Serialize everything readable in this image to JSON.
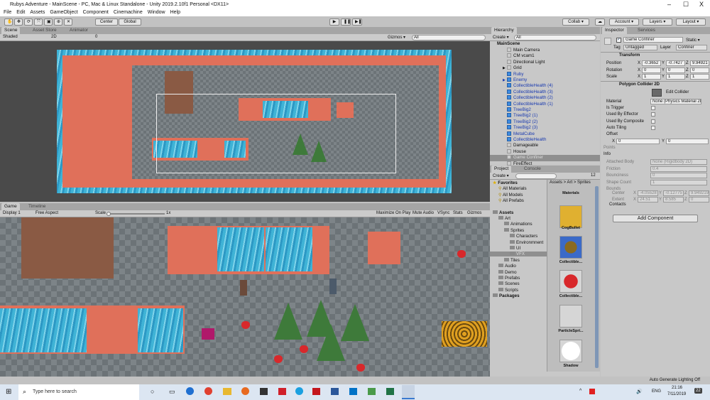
{
  "window": {
    "title": "Rubys Adventure - MainScene - PC, Mac & Linux Standalone - Unity 2019.2.10f1 Personal <DX11>",
    "minimize": "–",
    "maximize": "☐",
    "close": "X"
  },
  "menu": [
    "File",
    "Edit",
    "Assets",
    "GameObject",
    "Component",
    "Cinemachine",
    "Window",
    "Help"
  ],
  "toolbar": {
    "tools": [
      "✋",
      "✥",
      "⟳",
      "⤧",
      "▣",
      "⊕",
      "✕"
    ],
    "pivot": "Center",
    "space": "Global",
    "play": "▶",
    "pause": "❚❚",
    "step": "▶❚",
    "collab": "Collab ▾",
    "cloud": "☁",
    "account": "Account ▾",
    "layers": "Layers ▾",
    "layout": "Layout ▾"
  },
  "scene": {
    "tabs": [
      "Scene",
      "Asset Store",
      "Animator"
    ],
    "shading": "Shaded",
    "mode2d": "2D",
    "gizmos": "Gizmos ▾",
    "search_placeholder": "All",
    "fx_count": "0"
  },
  "game": {
    "tabs": [
      "Game",
      "Timeline"
    ],
    "display": "Display 1",
    "aspect": "Free Aspect",
    "scale_label": "Scale",
    "scale_value": "1x",
    "scale_fraction": 0.0,
    "buttons": [
      "Maximize On Play",
      "Mute Audio",
      "VSync",
      "Stats",
      "Gizmos"
    ]
  },
  "hierarchy": {
    "tab": "Hierarchy",
    "create": "Create ▾",
    "search_placeholder": "All",
    "scene": "MainScene",
    "items": [
      {
        "label": "Main Camera",
        "prefab": false
      },
      {
        "label": "CM vcam1",
        "prefab": false
      },
      {
        "label": "Directional Light",
        "prefab": false
      },
      {
        "label": "Grid",
        "prefab": false,
        "expand": true
      },
      {
        "label": "Ruby",
        "prefab": true
      },
      {
        "label": "Enemy",
        "prefab": true,
        "expand": true
      },
      {
        "label": "CollectibleHealth (4)",
        "prefab": true
      },
      {
        "label": "CollectibleHealth (3)",
        "prefab": true
      },
      {
        "label": "CollectibleHealth (2)",
        "prefab": true
      },
      {
        "label": "CollectibleHealth (1)",
        "prefab": true
      },
      {
        "label": "TreeBig2",
        "prefab": true
      },
      {
        "label": "TreeBig2 (1)",
        "prefab": true
      },
      {
        "label": "TreeBig2 (2)",
        "prefab": true
      },
      {
        "label": "TreeBig2 (3)",
        "prefab": true
      },
      {
        "label": "MetalCube",
        "prefab": true
      },
      {
        "label": "CollectibleHealth",
        "prefab": true
      },
      {
        "label": "Damageable",
        "prefab": false
      },
      {
        "label": "House",
        "prefab": false
      },
      {
        "label": "Game Confiner",
        "prefab": false,
        "selected": true
      },
      {
        "label": "FireEffect",
        "prefab": false
      }
    ]
  },
  "project": {
    "tabs": [
      "Project",
      "Console"
    ],
    "create": "Create ▾",
    "count": "12",
    "breadcrumb": [
      "Assets",
      "Art",
      "Sprites"
    ],
    "tree": [
      {
        "label": "Favorites",
        "level": 0,
        "bold": true,
        "icon": "star"
      },
      {
        "label": "All Materials",
        "level": 1,
        "icon": "search"
      },
      {
        "label": "All Models",
        "level": 1,
        "icon": "search"
      },
      {
        "label": "All Prefabs",
        "level": 1,
        "icon": "search"
      },
      {
        "label": "Assets",
        "level": 0,
        "bold": true,
        "gap": true
      },
      {
        "label": "Art",
        "level": 1
      },
      {
        "label": "Animations",
        "level": 2
      },
      {
        "label": "Sprites",
        "level": 2
      },
      {
        "label": "Characters",
        "level": 3
      },
      {
        "label": "Environmnent",
        "level": 3
      },
      {
        "label": "UI",
        "level": 3
      },
      {
        "label": "VFX",
        "level": 3,
        "selected": true
      },
      {
        "label": "Tiles",
        "level": 2
      },
      {
        "label": "Audio",
        "level": 1
      },
      {
        "label": "Demo",
        "level": 1
      },
      {
        "label": "Prefabs",
        "level": 1
      },
      {
        "label": "Scenes",
        "level": 1
      },
      {
        "label": "Scripts",
        "level": 1
      },
      {
        "label": "Packages",
        "level": 0,
        "bold": true
      }
    ],
    "assets": [
      "Materials",
      "CogBullet",
      "Collectible...",
      "Collectible...",
      "ParticleSpri...",
      "Shadow"
    ]
  },
  "inspector": {
    "tabs": [
      "Inspector",
      "Services"
    ],
    "object_name": "Game Confiner",
    "static": "Static ▾",
    "tag_label": "Tag",
    "tag": "Untagged",
    "layer_label": "Layer",
    "layer": "Confiner",
    "transform": {
      "title": "Transform",
      "position_label": "Position",
      "rotation_label": "Rotation",
      "scale_label": "Scale",
      "position": [
        "-0.3652",
        "-0.7427",
        "9.94921"
      ],
      "rotation": [
        "0",
        "0",
        "0"
      ],
      "scale": [
        "1",
        "1",
        "1"
      ]
    },
    "collider": {
      "title": "Polygon Collider 2D",
      "edit": "Edit Collider",
      "material_label": "Material",
      "material": "None (Physics Material 2D)",
      "is_trigger": "Is Trigger",
      "used_by_effector": "Used By Effector",
      "used_by_composite": "Used By Composite",
      "auto_tiling": "Auto Tiling",
      "offset_label": "Offset",
      "offset": [
        "0",
        "0"
      ],
      "points": "Points",
      "info": "Info",
      "attached_body_label": "Attached Body",
      "attached_body": "None (Rigidbody 2D)",
      "friction_label": "Friction",
      "friction": "0.4",
      "bounciness_label": "Bounciness",
      "bounciness": "0",
      "shape_count_label": "Shape Count",
      "shape_count": "1",
      "bounds_label": "Bounds",
      "center_label": "Center",
      "center": [
        "-4.05528",
        "-0.12775",
        "9.949219"
      ],
      "extent_label": "Extent",
      "extent": [
        "24.51",
        "8.585",
        "0"
      ],
      "contacts": "Contacts"
    },
    "add_component": "Add Component"
  },
  "status": {
    "lighting": "Auto Generate Lighting Off"
  },
  "taskbar": {
    "search_placeholder": "Type here to search",
    "lang": "ENG",
    "time": "21:16",
    "date": "7/11/2019",
    "notifications": "22"
  }
}
